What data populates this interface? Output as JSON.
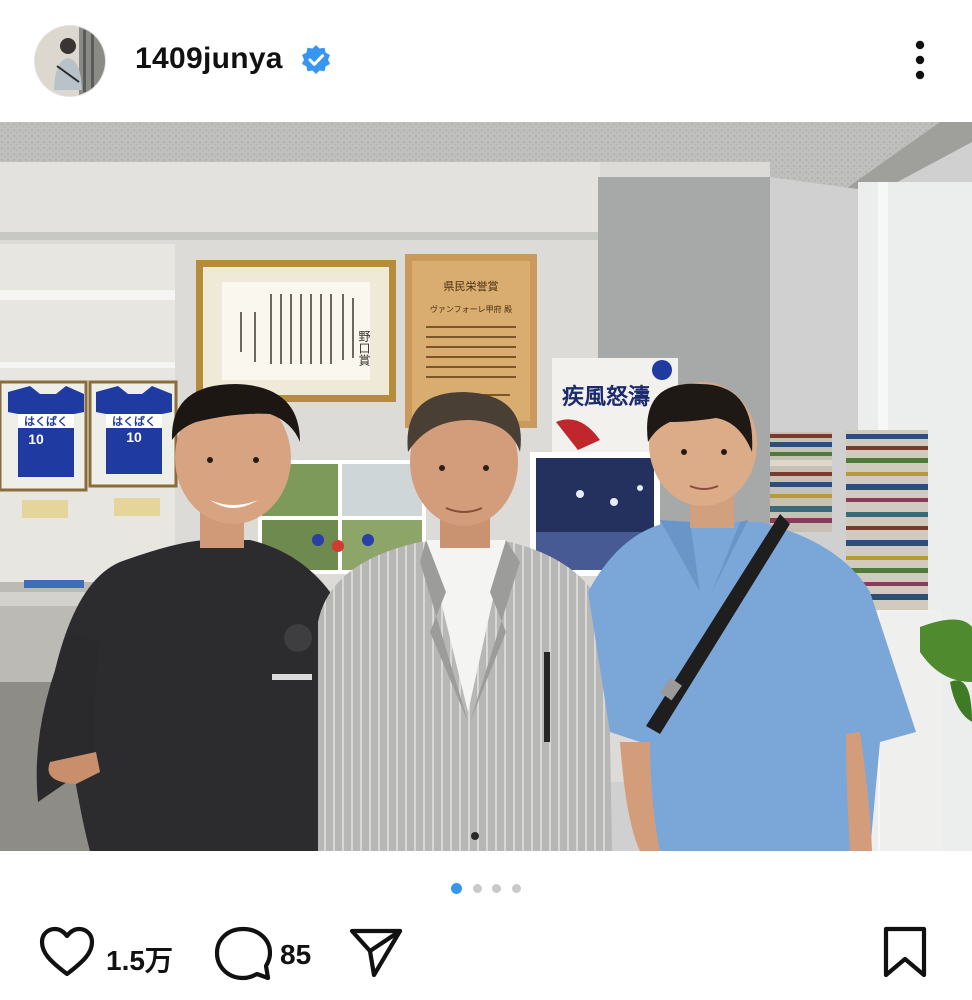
{
  "post": {
    "username": "1409junya",
    "verified": true,
    "likes": "1.5万",
    "comments": "85"
  },
  "carousel": {
    "total": 4,
    "active_index": 0
  },
  "photo_text": {
    "certificate_title": "野口賞",
    "plaque_title": "県民栄誉賞",
    "plaque_subtitle": "ヴァンフォーレ甲府 殿",
    "jersey_sponsor": "はくばく",
    "jersey_number": "10",
    "poster_title": "疾風怒濤"
  },
  "icons": {
    "verified": "verified-badge-icon",
    "more": "more-vertical-icon",
    "like": "heart-icon",
    "comment": "comment-bubble-icon",
    "share": "paper-plane-icon",
    "save": "bookmark-icon"
  },
  "colors": {
    "verified_blue": "#3797f0",
    "text": "#111111",
    "dot_active": "#3797f0",
    "dot_inactive": "#c9c9c9"
  }
}
